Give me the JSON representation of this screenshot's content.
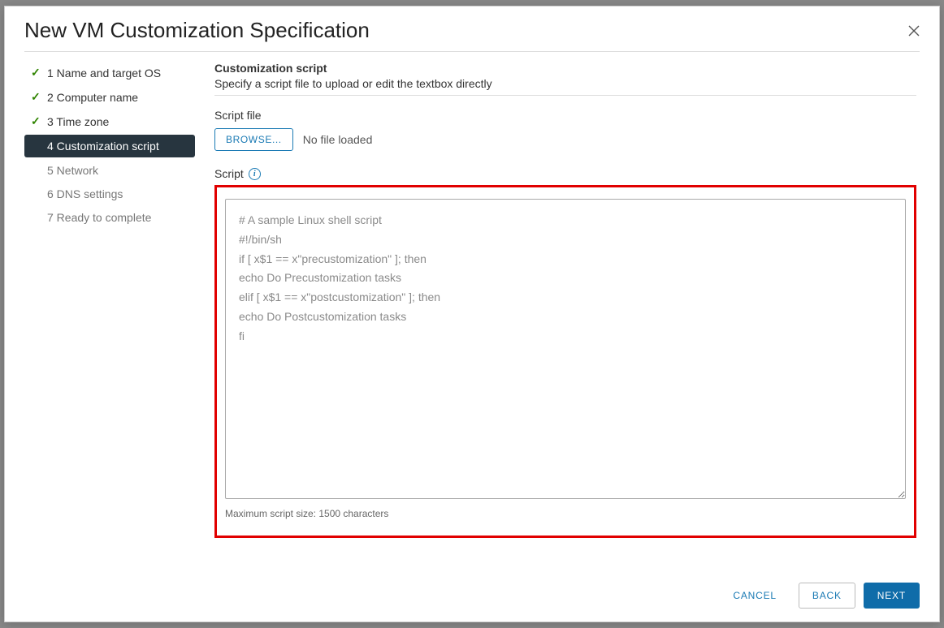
{
  "modal": {
    "title": "New VM Customization Specification",
    "close_name": "close-icon"
  },
  "steps": [
    {
      "label": "1 Name and target OS",
      "state": "done"
    },
    {
      "label": "2 Computer name",
      "state": "done"
    },
    {
      "label": "3 Time zone",
      "state": "done"
    },
    {
      "label": "4 Customization script",
      "state": "current"
    },
    {
      "label": "5 Network",
      "state": "pending"
    },
    {
      "label": "6 DNS settings",
      "state": "pending"
    },
    {
      "label": "7 Ready to complete",
      "state": "pending"
    }
  ],
  "section": {
    "title": "Customization script",
    "subtitle": "Specify a script file to upload or edit the textbox directly"
  },
  "file": {
    "label": "Script file",
    "browse": "BROWSE...",
    "status": "No file loaded"
  },
  "script": {
    "label": "Script",
    "placeholder": "# A sample Linux shell script\n#!/bin/sh\nif [ x$1 == x\"precustomization\" ]; then\necho Do Precustomization tasks\nelif [ x$1 == x\"postcustomization\" ]; then\necho Do Postcustomization tasks\nfi",
    "maxnote": "Maximum script size: 1500 characters"
  },
  "footer": {
    "cancel": "CANCEL",
    "back": "BACK",
    "next": "NEXT"
  }
}
